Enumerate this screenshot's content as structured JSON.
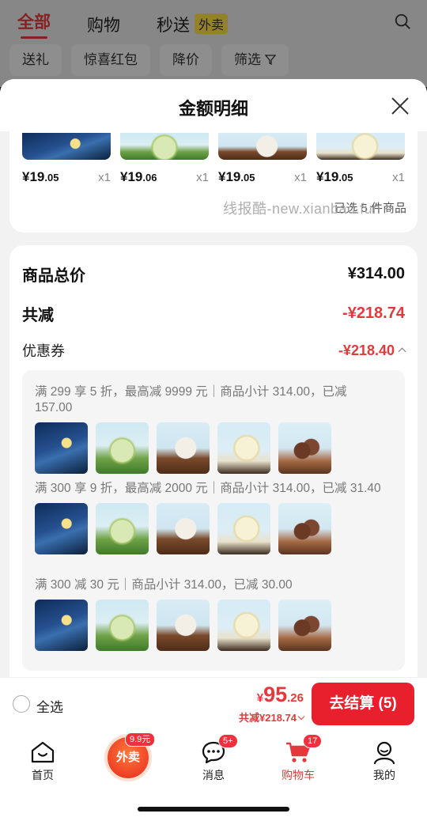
{
  "background": {
    "tabs": [
      {
        "label": "全部",
        "active": true
      },
      {
        "label": "购物",
        "active": false
      },
      {
        "label": "秒送",
        "active": false,
        "badge": "外卖"
      }
    ],
    "filters": [
      "送礼",
      "惊喜红包",
      "降价",
      "筛选"
    ]
  },
  "sheet": {
    "title": "金额明细",
    "items": [
      {
        "price_int": "¥19",
        "price_dec": ".05",
        "qty": "x1",
        "art": "blue"
      },
      {
        "price_int": "¥19",
        "price_dec": ".06",
        "qty": "x1",
        "art": "green"
      },
      {
        "price_int": "¥19",
        "price_dec": ".05",
        "qty": "x1",
        "art": "chocolate"
      },
      {
        "price_int": "¥19",
        "price_dec": ".05",
        "qty": "x1",
        "art": "vanilla"
      }
    ],
    "selected_note": "已选 5 件商品",
    "watermark": "线报酷-new.xianbao.fun"
  },
  "summary": {
    "goods_total_label": "商品总价",
    "goods_total_value": "¥314.00",
    "reduce_label": "共减",
    "reduce_value": "-¥218.74",
    "coupon_label": "优惠券",
    "coupon_value": "-¥218.40"
  },
  "promotions": [
    {
      "text": "满 299 享 5 折，最高减 9999 元｜商品小计 314.00，已减 157.00"
    },
    {
      "text": "满 300 享 9 折，最高减 2000 元｜商品小计 314.00，已减 31.40"
    },
    {
      "text": "满 300 减 30 元｜商品小计 314.00，已减 30.00"
    }
  ],
  "product_art": [
    "blue",
    "green",
    "chocolate",
    "vanilla",
    "chocolate2"
  ],
  "bottom": {
    "select_all": "全选",
    "total_currency": "¥",
    "total_int": "95",
    "total_dec": ".26",
    "total_reduce": "共减¥218.74",
    "checkout": "去结算 (5)"
  },
  "tabbar": {
    "home": "首页",
    "waimai": "外卖",
    "waimai_tag": "9.9元",
    "messages": "消息",
    "messages_badge": "5+",
    "cart": "购物车",
    "cart_badge": "17",
    "me": "我的"
  },
  "colors": {
    "accent": "#e4393c",
    "checkout": "#e81f2d"
  }
}
